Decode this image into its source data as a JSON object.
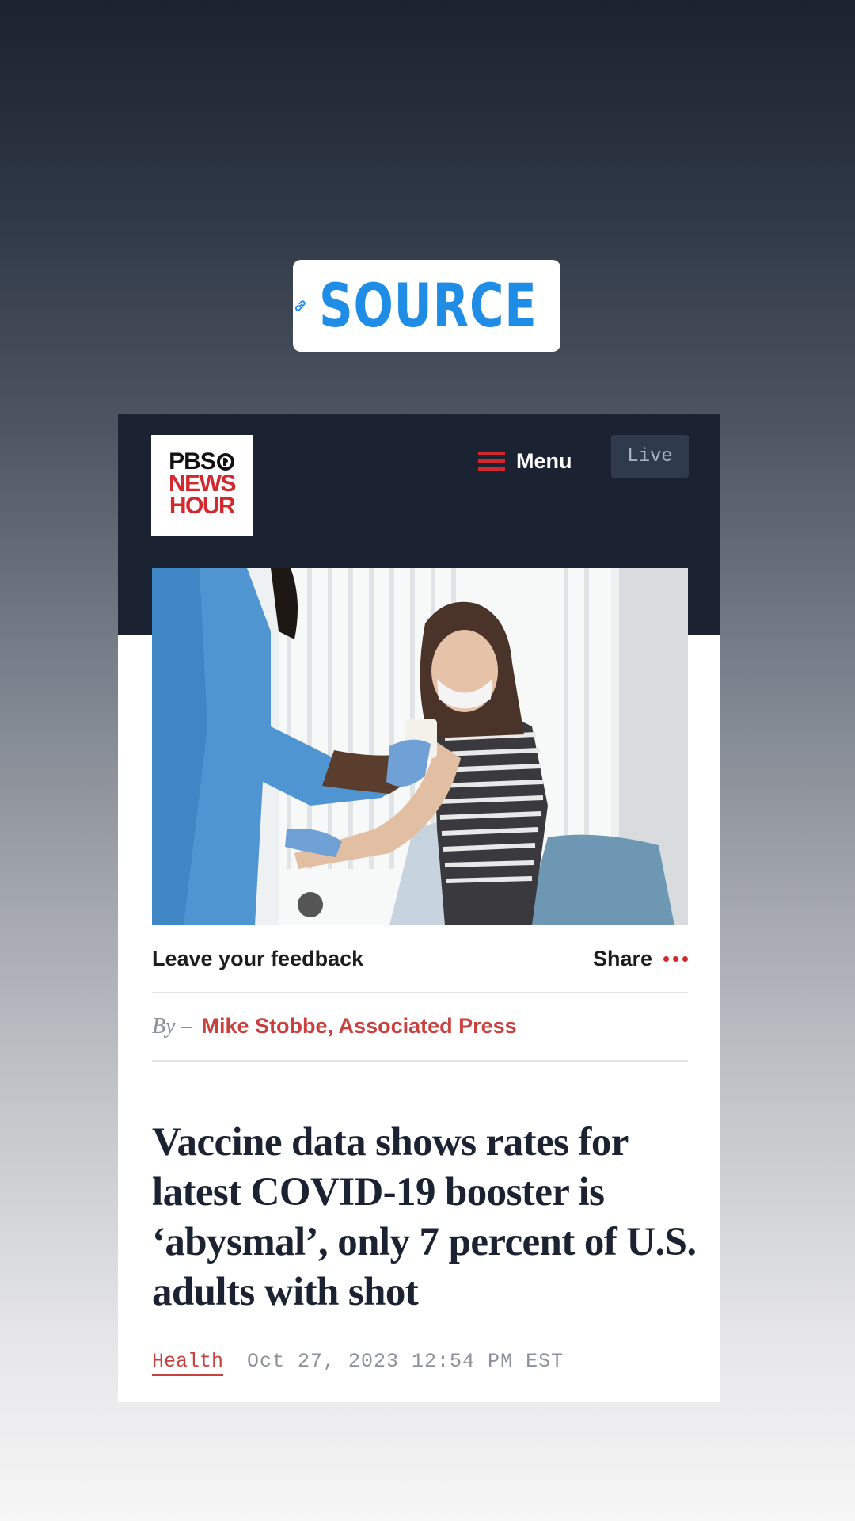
{
  "sticker": {
    "label": "SOURCE",
    "icon": "link-icon",
    "color": "#1f8de6"
  },
  "site_header": {
    "logo_lines": [
      "PBS",
      "NEWS",
      "HOUR"
    ],
    "menu_label": "Menu",
    "menu_icon": "hamburger-icon",
    "live_label": "Live",
    "colors": {
      "header_bg": "#1b2231",
      "accent": "#d2282e"
    }
  },
  "article": {
    "feedback_label": "Leave your feedback",
    "share_label": "Share",
    "share_icon": "more-dots-icon",
    "byline_prefix": "By –",
    "author": "Mike Stobbe, Associated Press",
    "headline": "Vaccine data shows rates for latest COVID-19 booster is ‘abysmal’, only 7 percent of U.S. adults with shot",
    "category": "Health",
    "date": "Oct 27, 2023 12:54 PM EST",
    "colors": {
      "accent_red": "#c9413f",
      "headline": "#1b2231"
    }
  }
}
